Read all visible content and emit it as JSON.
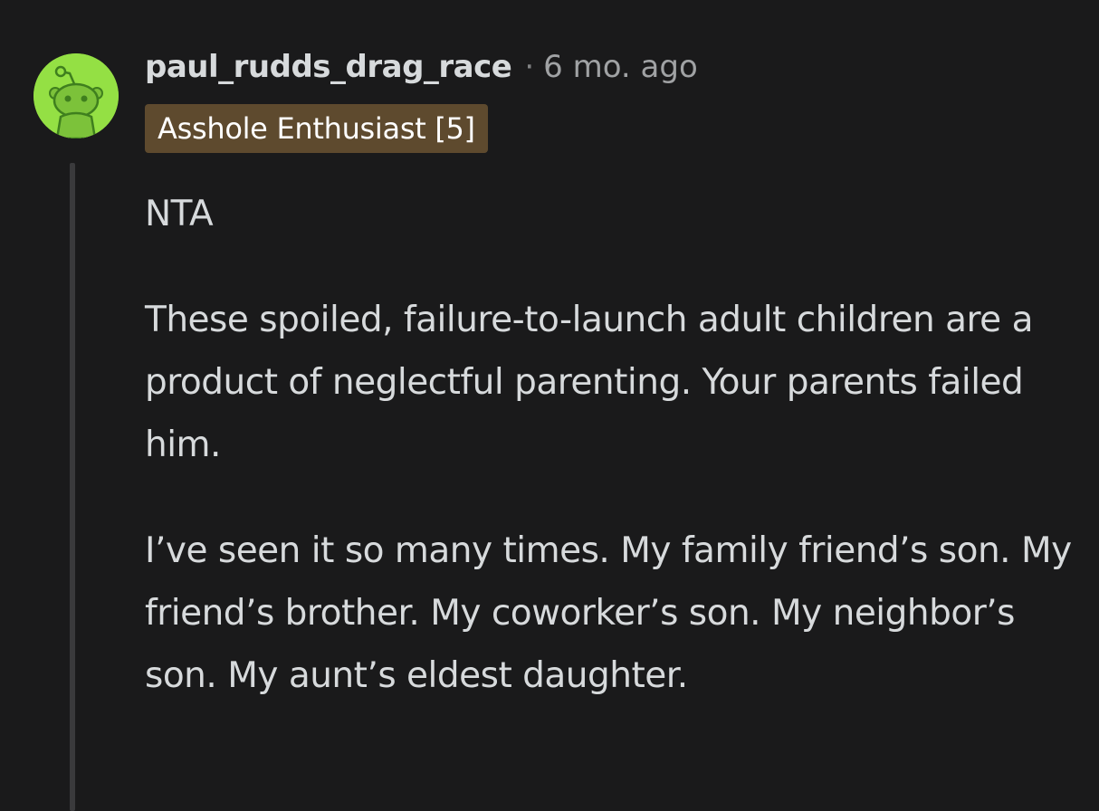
{
  "comment": {
    "username": "paul_rudds_drag_race",
    "separator": "·",
    "timestamp": "6 mo. ago",
    "flair": "Asshole Enthusiast [5]",
    "avatar_icon": "snoo-avatar-icon",
    "colors": {
      "background": "#1a1a1b",
      "avatar_bg": "#94e044",
      "flair_bg": "#5e4a2e",
      "text": "#d7dadc",
      "muted": "#a0a2a4"
    },
    "paragraphs": [
      "NTA",
      "These spoiled, failure-to-launch adult children are a product of neglectful parenting. Your parents failed him.",
      "I’ve seen it so many times. My family friend’s son. My friend’s brother. My coworker’s son. My neighbor’s son. My aunt’s eldest daughter."
    ]
  }
}
